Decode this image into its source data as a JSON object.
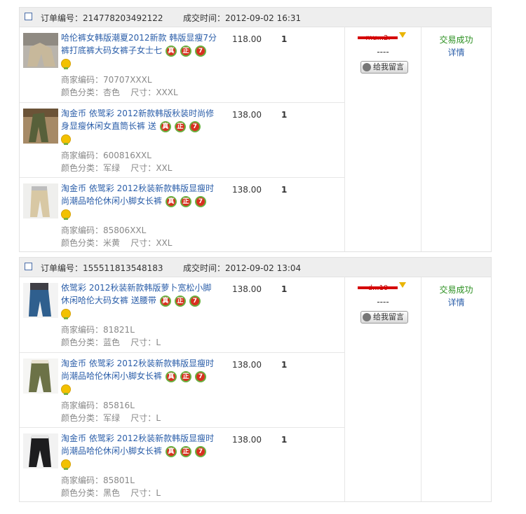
{
  "orders": [
    {
      "order_label": "订单编号：",
      "order_no": "214778203492122",
      "time_label": "成交时间：",
      "time": "2012-09-02 16:31",
      "buyer_redacted": "mu,..2.",
      "dash": "----",
      "message_button": "给我留言",
      "status": "交易成功",
      "detail": "详情",
      "items": [
        {
          "title": "哈伦裤女韩版潮夏2012新款 韩版显瘦7分裤打底裤大码女裤子女士七",
          "price": "118.00",
          "qty": "1",
          "code_label": "商家编码：",
          "code": "70707XXXL",
          "color_label": "颜色分类：",
          "color": "杏色",
          "size_label": "尺寸：",
          "size": "XXXL",
          "icon_zhen": "真",
          "icon_zheng": "正",
          "icon_seven": "7"
        },
        {
          "title": "淘金币 依鹭彩 2012新款韩版秋装时尚修身显瘦休闲女直筒长裤 送",
          "price": "138.00",
          "qty": "1",
          "code_label": "商家编码：",
          "code": "600816XXL",
          "color_label": "颜色分类：",
          "color": "军绿",
          "size_label": "尺寸：",
          "size": "XXL",
          "icon_zhen": "真",
          "icon_zheng": "正",
          "icon_seven": "7"
        },
        {
          "title": "淘金币 依鹭彩 2012秋装新款韩版显瘦时尚潮品哈伦休闲小脚女长裤",
          "price": "138.00",
          "qty": "1",
          "code_label": "商家编码：",
          "code": "85806XXL",
          "color_label": "颜色分类：",
          "color": "米黄",
          "size_label": "尺寸：",
          "size": "XXL",
          "icon_zhen": "真",
          "icon_zheng": "正",
          "icon_seven": "7"
        }
      ]
    },
    {
      "order_label": "订单编号：",
      "order_no": "155511813548183",
      "time_label": "成交时间：",
      "time": "2012-09-02 13:04",
      "buyer_redacted": "d...10",
      "dash": "----",
      "message_button": "给我留言",
      "status": "交易成功",
      "detail": "详情",
      "items": [
        {
          "title": "依鹭彩 2012秋装新款韩版萝卜宽松小脚休闲哈伦大码女裤 送腰带",
          "price": "138.00",
          "qty": "1",
          "code_label": "商家编码：",
          "code": "81821L",
          "color_label": "颜色分类：",
          "color": "蓝色",
          "size_label": "尺寸：",
          "size": "L",
          "icon_zhen": "真",
          "icon_zheng": "正",
          "icon_seven": "7"
        },
        {
          "title": "淘金币 依鹭彩 2012秋装新款韩版显瘦时尚潮品哈伦休闲小脚女长裤",
          "price": "138.00",
          "qty": "1",
          "code_label": "商家编码：",
          "code": "85816L",
          "color_label": "颜色分类：",
          "color": "军绿",
          "size_label": "尺寸：",
          "size": "L",
          "icon_zhen": "真",
          "icon_zheng": "正",
          "icon_seven": "7"
        },
        {
          "title": "淘金币 依鹭彩 2012秋装新款韩版显瘦时尚潮品哈伦休闲小脚女长裤",
          "price": "138.00",
          "qty": "1",
          "code_label": "商家编码：",
          "code": "85801L",
          "color_label": "颜色分类：",
          "color": "黑色",
          "size_label": "尺寸：",
          "size": "L",
          "icon_zhen": "真",
          "icon_zheng": "正",
          "icon_seven": "7"
        }
      ]
    }
  ]
}
